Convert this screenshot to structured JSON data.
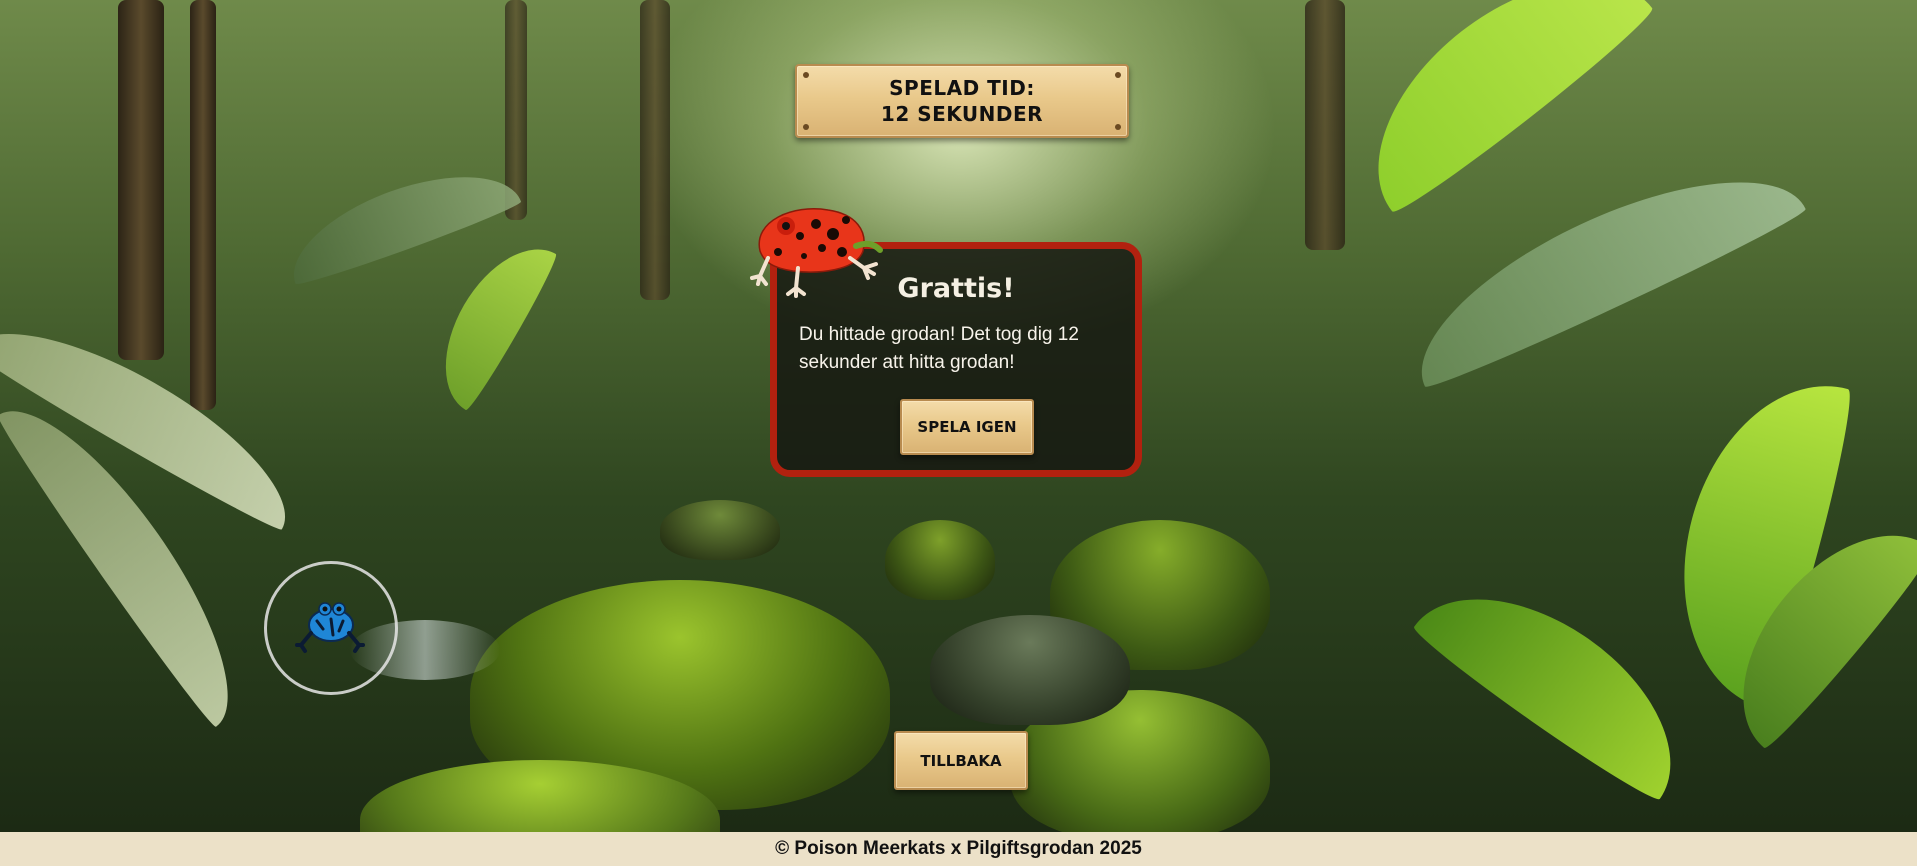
{
  "time_sign": {
    "line1": "SPELAD TID:",
    "line2": "12 SEKUNDER"
  },
  "dialog": {
    "title": "Grattis!",
    "message": "Du hittade grodan! Det tog dig 12 sekunder att hitta grodan!",
    "play_again_label": "SPELA IGEN"
  },
  "back_button": {
    "label": "TILLBAKA"
  },
  "footer": {
    "text": "© Poison Meerkats x Pilgiftsgrodan 2025"
  },
  "colors": {
    "dialog_border": "#b2210f",
    "wood": "#e9c98b",
    "footer_bg": "#ece1c8",
    "red_frog": "#e8351a",
    "blue_frog": "#1f86d6"
  },
  "icons": {
    "red_frog": "red-poison-dart-frog",
    "blue_frog": "blue-poison-dart-frog"
  }
}
